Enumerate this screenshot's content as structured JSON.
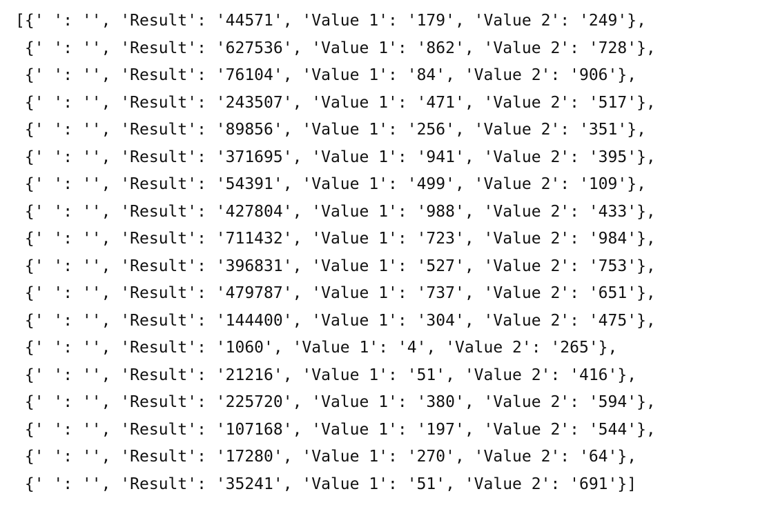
{
  "output": {
    "lines": [
      "[{' ': '', 'Result': '44571', 'Value 1': '179', 'Value 2': '249'},",
      " {' ': '', 'Result': '627536', 'Value 1': '862', 'Value 2': '728'},",
      " {' ': '', 'Result': '76104', 'Value 1': '84', 'Value 2': '906'},",
      " {' ': '', 'Result': '243507', 'Value 1': '471', 'Value 2': '517'},",
      " {' ': '', 'Result': '89856', 'Value 1': '256', 'Value 2': '351'},",
      " {' ': '', 'Result': '371695', 'Value 1': '941', 'Value 2': '395'},",
      " {' ': '', 'Result': '54391', 'Value 1': '499', 'Value 2': '109'},",
      " {' ': '', 'Result': '427804', 'Value 1': '988', 'Value 2': '433'},",
      " {' ': '', 'Result': '711432', 'Value 1': '723', 'Value 2': '984'},",
      " {' ': '', 'Result': '396831', 'Value 1': '527', 'Value 2': '753'},",
      " {' ': '', 'Result': '479787', 'Value 1': '737', 'Value 2': '651'},",
      " {' ': '', 'Result': '144400', 'Value 1': '304', 'Value 2': '475'},",
      " {' ': '', 'Result': '1060', 'Value 1': '4', 'Value 2': '265'},",
      " {' ': '', 'Result': '21216', 'Value 1': '51', 'Value 2': '416'},",
      " {' ': '', 'Result': '225720', 'Value 1': '380', 'Value 2': '594'},",
      " {' ': '', 'Result': '107168', 'Value 1': '197', 'Value 2': '544'},",
      " {' ': '', 'Result': '17280', 'Value 1': '270', 'Value 2': '64'},",
      " {' ': '', 'Result': '35241', 'Value 1': '51', 'Value 2': '691'}]"
    ]
  }
}
